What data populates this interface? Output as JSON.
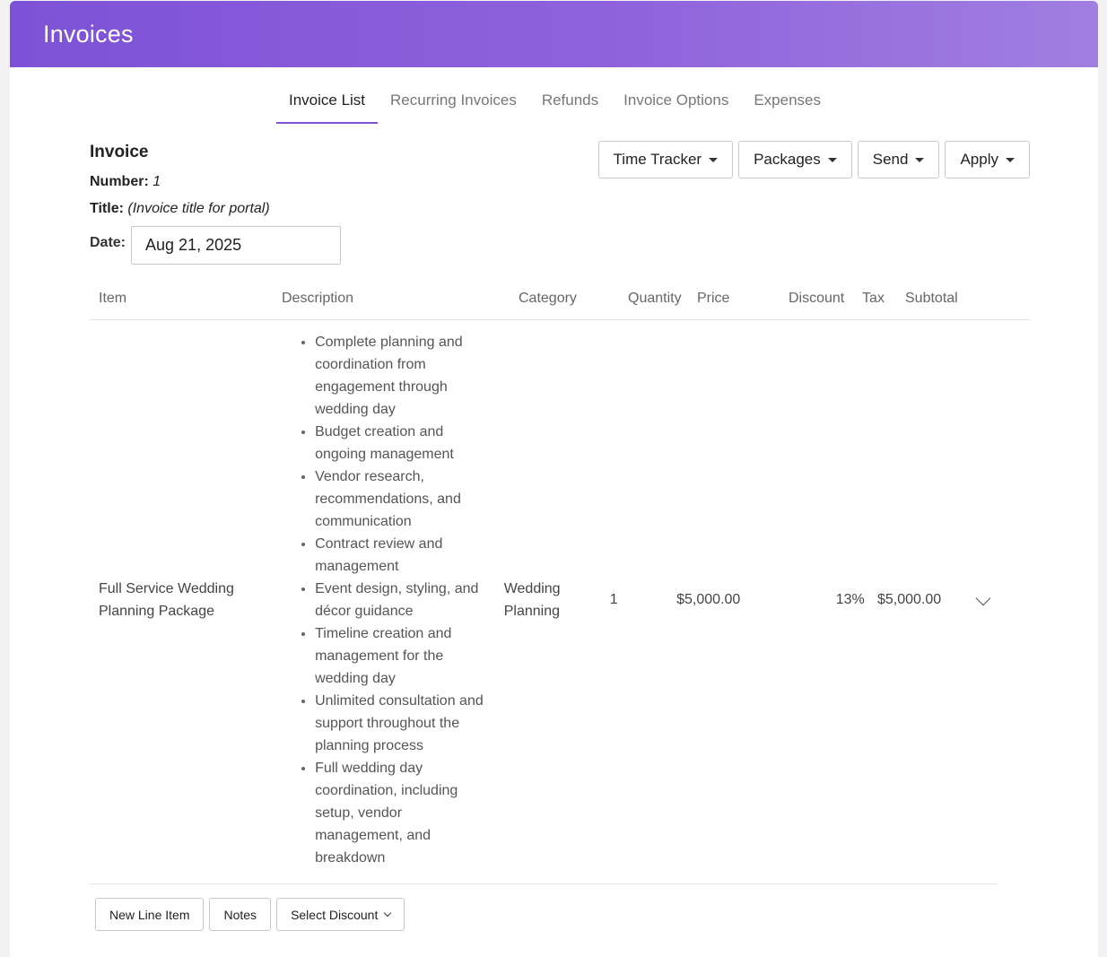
{
  "header": {
    "title": "Invoices"
  },
  "tabs": [
    {
      "label": "Invoice List",
      "active": true
    },
    {
      "label": "Recurring Invoices",
      "active": false
    },
    {
      "label": "Refunds",
      "active": false
    },
    {
      "label": "Invoice Options",
      "active": false
    },
    {
      "label": "Expenses",
      "active": false
    }
  ],
  "invoice": {
    "heading": "Invoice",
    "number_label": "Number:",
    "number_value": "1",
    "title_label": "Title:",
    "title_value": "(Invoice title for portal)",
    "date_label": "Date:",
    "date_value": "Aug 21, 2025"
  },
  "actions": {
    "time_tracker": "Time Tracker",
    "packages": "Packages",
    "send": "Send",
    "apply": "Apply"
  },
  "table": {
    "headers": {
      "item": "Item",
      "description": "Description",
      "category": "Category",
      "quantity": "Quantity",
      "price": "Price",
      "discount": "Discount",
      "tax": "Tax",
      "subtotal": "Subtotal"
    },
    "rows": [
      {
        "item": "Full Service Wedding Planning Package",
        "description": [
          "Complete planning and coordination from engagement through wedding day",
          "Budget creation and ongoing management",
          "Vendor research, recommendations, and communication",
          "Contract review and management",
          "Event design, styling, and décor guidance",
          "Timeline creation and management for the wedding day",
          "Unlimited consultation and support throughout the planning process",
          "Full wedding day coordination, including setup, vendor management, and breakdown"
        ],
        "category": "Wedding Planning",
        "quantity": "1",
        "price": "$5,000.00",
        "discount": "",
        "tax": "13%",
        "subtotal": "$5,000.00"
      }
    ]
  },
  "footer": {
    "new_line_item": "New Line Item",
    "notes": "Notes",
    "select_discount": "Select Discount"
  },
  "colors": {
    "accent": "#7d52d6",
    "header_end": "#a07fe0"
  }
}
